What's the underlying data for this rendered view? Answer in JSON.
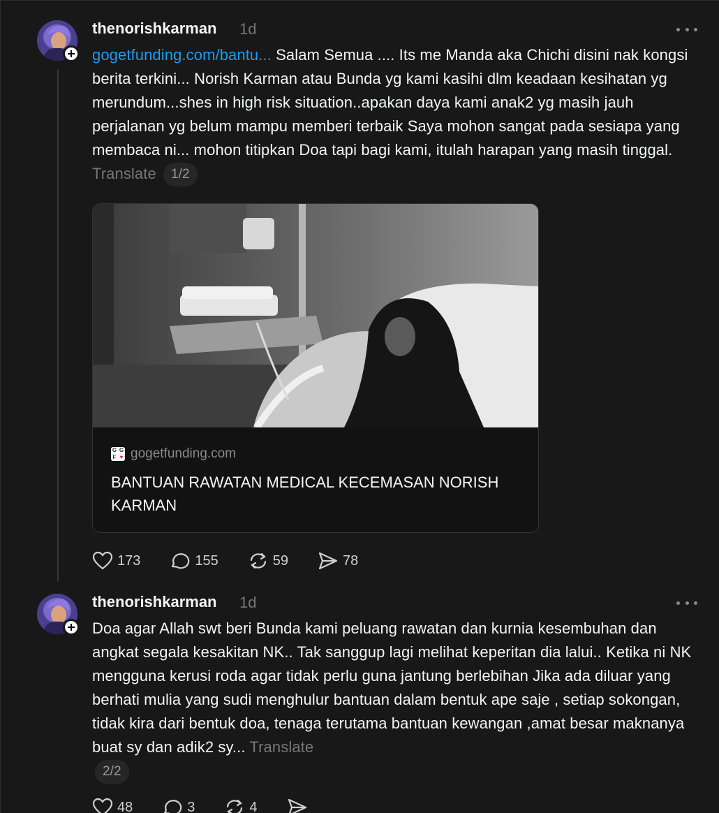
{
  "posts": [
    {
      "username": "thenorishkarman",
      "time": "1d",
      "link_text": "gogetfunding.com/bantu...",
      "text": " Salam Semua .... Its me Manda aka Chichi disini nak kongsi berita terkini... Norish Karman atau Bunda yg kami kasihi dlm keadaan kesihatan yg merundum...shes in high risk situation..apakan daya kami anak2 yg masih jauh perjalanan yg belum mampu memberi terbaik Saya mohon sangat pada sesiapa yang membaca ni... mohon titipkan Doa tapi bagi kami, itulah harapan yang masih tinggal.",
      "translate_label": "Translate",
      "page_indicator": "1/2",
      "link_card": {
        "domain": "gogetfunding.com",
        "title": "BANTUAN RAWATAN MEDICAL KECEMASAN NORISH KARMAN",
        "favicon_letters": [
          "G",
          "G",
          "F",
          "♥"
        ]
      },
      "stats": {
        "likes": "173",
        "replies": "155",
        "reposts": "59",
        "shares": "78"
      }
    },
    {
      "username": "thenorishkarman",
      "time": "1d",
      "text": "Doa agar Allah swt beri Bunda kami peluang rawatan dan kurnia kesembuhan dan angkat segala kesakitan NK.. Tak sanggup lagi melihat keperitan dia lalui.. Ketika ni NK mengguna kerusi roda agar tidak perlu guna jantung berlebihan Jika ada diluar yang berhati mulia yang sudi menghulur bantuan dalam bentuk ape saje , setiap sokongan, tidak kira dari bentuk doa, tenaga terutama bantuan kewangan ,amat besar maknanya buat sy dan adik2 sy...",
      "translate_label": "Translate",
      "page_indicator": "2/2",
      "stats": {
        "likes": "48",
        "replies": "3",
        "reposts": "4",
        "shares": ""
      }
    }
  ],
  "colors": {
    "background": "#181818",
    "link": "#1d9bf0",
    "muted": "#777777"
  },
  "icons": [
    "heart-icon",
    "comment-icon",
    "repost-icon",
    "share-icon",
    "plus-icon",
    "more-icon"
  ]
}
